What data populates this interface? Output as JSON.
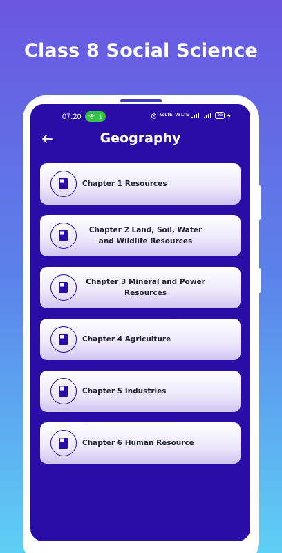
{
  "promo": {
    "title": "Class 8 Social Science"
  },
  "status_bar": {
    "time": "07:20",
    "hotspot_count": "1",
    "network_label_1": "VoLTE",
    "network_label_2": "Vo LTE",
    "battery": "55"
  },
  "app_bar": {
    "title": "Geography",
    "back_icon": "arrow-left-icon"
  },
  "chapters": [
    {
      "label": "Chapter 1 Resources",
      "icon": "book-icon"
    },
    {
      "label": "Chapter 2 Land, Soil, Water and Wildlife Resources",
      "icon": "book-icon"
    },
    {
      "label": "Chapter 3 Mineral and Power Resources",
      "icon": "book-icon"
    },
    {
      "label": "Chapter 4 Agriculture",
      "icon": "book-icon"
    },
    {
      "label": "Chapter 5 Industries",
      "icon": "book-icon"
    },
    {
      "label": "Chapter 6 Human Resource",
      "icon": "book-icon"
    }
  ],
  "colors": {
    "screen_bg": "#2a0da6",
    "hotspot_green": "#36c24a",
    "card_text": "#222233",
    "icon_fill": "#2a0da6"
  }
}
